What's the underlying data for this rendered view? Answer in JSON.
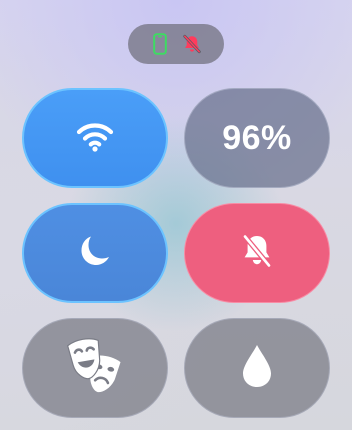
{
  "status": {
    "phone_icon": "phone-connected-icon",
    "phone_color": "#3ddc62",
    "silent_icon": "bell-slash-icon",
    "silent_color": "#ff3b5c"
  },
  "controls": {
    "wifi": {
      "icon": "wifi-icon",
      "active": true,
      "color": "#3f90ef"
    },
    "battery": {
      "label": "96%",
      "active": false
    },
    "focus": {
      "icon": "moon-icon",
      "active": true,
      "color": "#4a86d8"
    },
    "silent_mode": {
      "icon": "bell-slash-icon",
      "active": true,
      "color": "#ee5f7f"
    },
    "theater_mode": {
      "icon": "theater-masks-icon",
      "active": false
    },
    "water_lock": {
      "icon": "water-drop-icon",
      "active": false
    }
  }
}
